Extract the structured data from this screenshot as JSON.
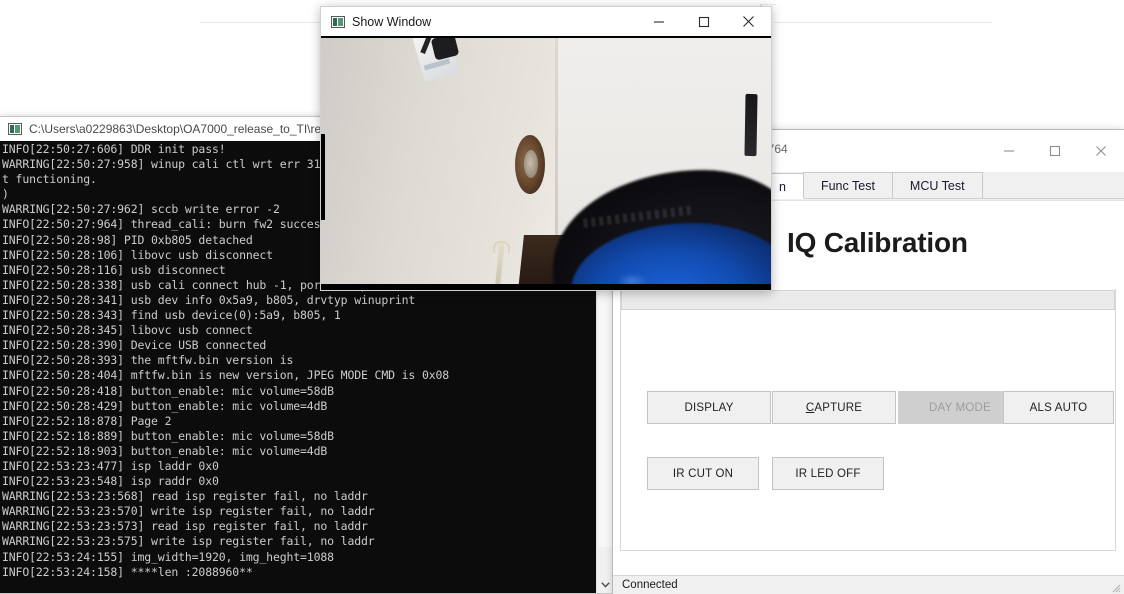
{
  "console_window": {
    "title": "C:\\Users\\a0229863\\Desktop\\OA7000_release_to_TI\\release\\",
    "icon": "cmd-prompt-icon",
    "log_text": "INFO[22:50:27:606] DDR init pass!\nWARRING[22:50:27:958] winup cali ctl wrt err 31\nt functioning.\n)\nWARRING[22:50:27:962] sccb write error -2\nINFO[22:50:27:964] thread_cali: burn fw2 success\nINFO[22:50:28:98] PID 0xb805 detached\nINFO[22:50:28:106] libovc usb disconnect\nINFO[22:50:28:116] usb disconnect\nINFO[22:50:28:338] usb cali connect hub -1, port -2, pid 805\nINFO[22:50:28:341] usb dev info 0x5a9, b805, drvtyp winuprint\nINFO[22:50:28:343] find usb device(0):5a9, b805, 1\nINFO[22:50:28:345] libovc usb connect\nINFO[22:50:28:390] Device USB connected\nINFO[22:50:28:393] the mftfw.bin version is\nINFO[22:50:28:404] mftfw.bin is new version, JPEG MODE CMD is 0x08\nINFO[22:50:28:418] button_enable: mic volume=58dB\nINFO[22:50:28:429] button_enable: mic volume=4dB\nINFO[22:52:18:878] Page 2\nINFO[22:52:18:889] button_enable: mic volume=58dB\nINFO[22:52:18:903] button_enable: mic volume=4dB\nINFO[22:53:23:477] isp laddr 0x0\nINFO[22:53:23:548] isp raddr 0x0\nWARRING[22:53:23:568] read isp register fail, no laddr\nWARRING[22:53:23:570] write isp register fail, no laddr\nWARRING[22:53:23:573] read isp register fail, no laddr\nWARRING[22:53:23:575] write isp register fail, no laddr\nINFO[22:53:24:155] img_width=1920, img_heght=1088\nINFO[22:53:24:158] ****len :2088960**",
    "scrollbar": {
      "down_arrow": "chevron-down-icon"
    }
  },
  "show_window": {
    "title": "Show Window",
    "icon": "app-icon",
    "controls": {
      "minimize": "minimize-icon",
      "maximize": "maximize-icon",
      "close": "close-icon"
    }
  },
  "app_window": {
    "title": "5764",
    "controls": {
      "minimize": "minimize-icon",
      "maximize": "maximize-icon",
      "close": "close-icon"
    },
    "tabs": [
      {
        "label": "n",
        "active": true
      },
      {
        "label": "Func Test",
        "active": false
      },
      {
        "label": "MCU Test",
        "active": false
      }
    ],
    "heading": "IQ Calibration",
    "buttons": [
      {
        "label": "DISPLAY",
        "mnemonic": "",
        "disabled": false
      },
      {
        "label": "CAPTURE",
        "mnemonic": "C",
        "disabled": false
      },
      {
        "label": "DAY MODE",
        "mnemonic": "",
        "disabled": true
      },
      {
        "label": "ALS AUTO",
        "mnemonic": "",
        "disabled": false
      },
      {
        "label": "IR CUT ON",
        "mnemonic": "",
        "disabled": false
      },
      {
        "label": "IR LED OFF",
        "mnemonic": "",
        "disabled": false
      }
    ],
    "status": "Connected",
    "resize_grip": "resize-grip-icon"
  },
  "colors": {
    "console_bg": "#0c0c0c",
    "console_fg": "#cccccc",
    "window_chrome": "#f0f0f0",
    "disabled_button": "#cfcfcf",
    "device_blue": "#124bb0"
  }
}
